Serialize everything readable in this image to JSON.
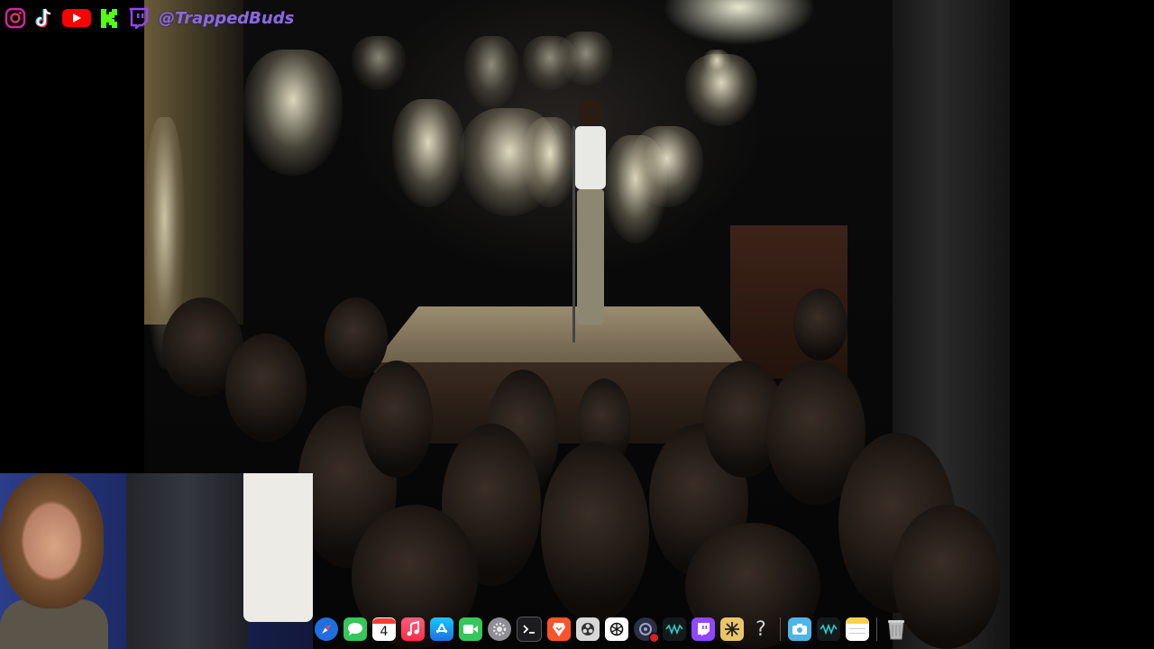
{
  "overlay": {
    "handle": "@TrappedBuds",
    "social_icons": [
      {
        "name": "instagram",
        "color": "#d6249f"
      },
      {
        "name": "tiktok",
        "color": "#ffffff"
      },
      {
        "name": "youtube",
        "color": "#ff0000"
      },
      {
        "name": "kick",
        "color": "#53fc18"
      },
      {
        "name": "twitch",
        "color": "#9146ff"
      }
    ]
  },
  "dock": {
    "calendar_day": "4",
    "help_glyph": "?",
    "items": [
      "safari",
      "messages",
      "calendar",
      "music",
      "app-store",
      "facetime",
      "system-settings",
      "terminal",
      "brave",
      "obs",
      "chatgpt",
      "screen-recorder",
      "audio-app",
      "twitch",
      "perplexity",
      "help",
      "screenshot",
      "audio-app-2",
      "notes",
      "trash"
    ]
  }
}
